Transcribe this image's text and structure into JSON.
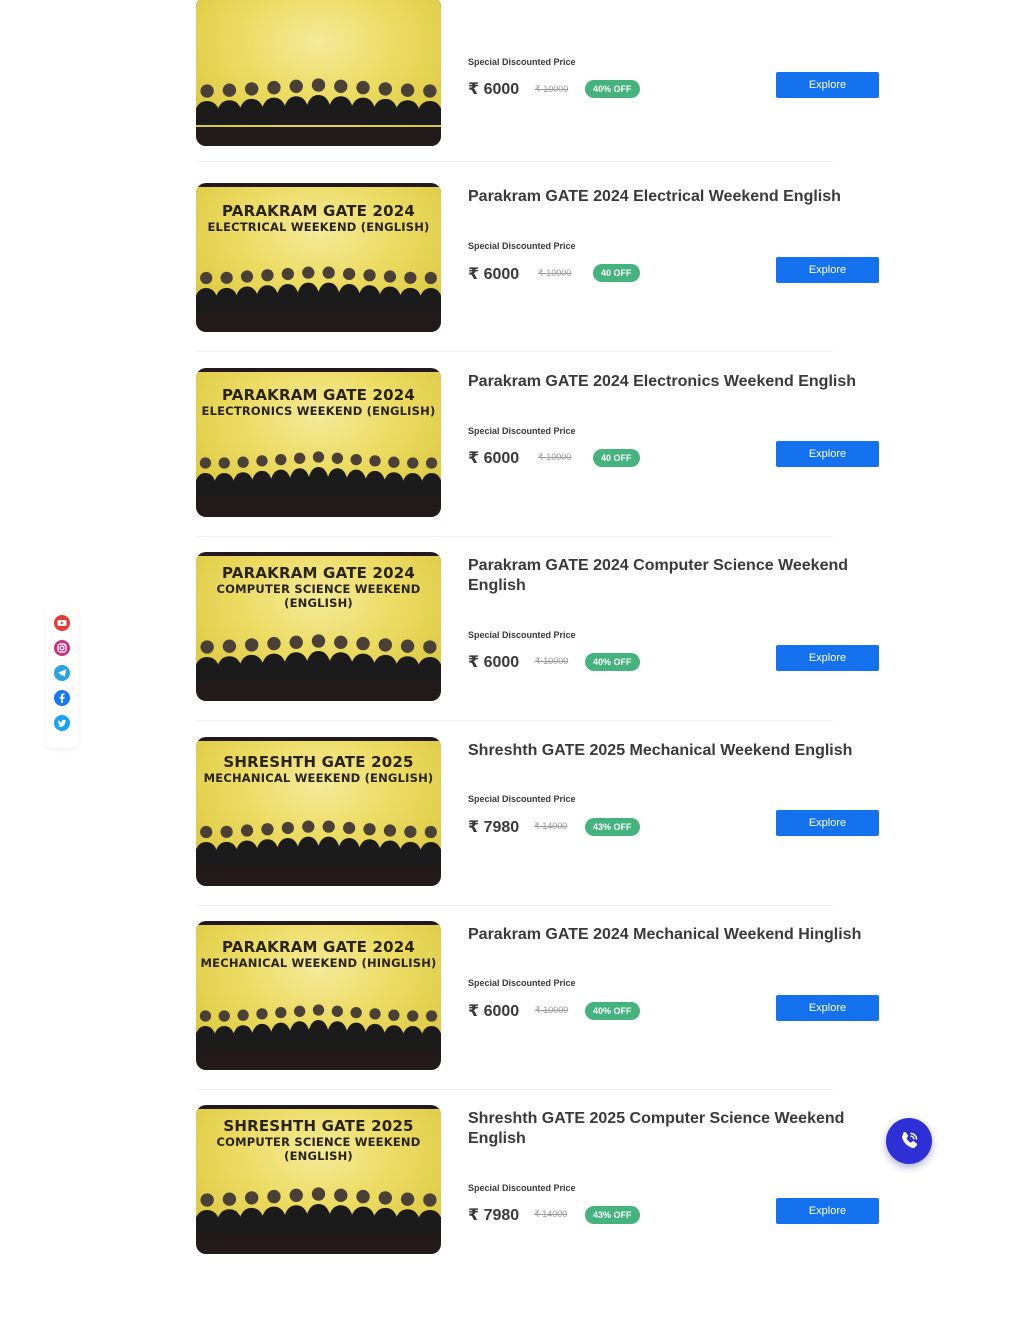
{
  "courses": [
    {
      "thumb_line1": "",
      "thumb_line2": "",
      "thumb_line3": "",
      "title": "",
      "price_label": "Special Discounted Price",
      "price": "₹ 6000",
      "mrp": "₹ 10000",
      "discount": "40% OFF",
      "explore_label": "Explore"
    },
    {
      "thumb_line1": "PARAKRAM GATE 2024",
      "thumb_line2": "ELECTRICAL WEEKEND (ENGLISH)",
      "thumb_line3": "",
      "title": "Parakram GATE 2024 Electrical Weekend English",
      "price_label": "Special Discounted Price",
      "price": "₹ 6000",
      "mrp": "₹ 10000",
      "discount": "40 OFF",
      "explore_label": "Explore"
    },
    {
      "thumb_line1": "PARAKRAM GATE 2024",
      "thumb_line2": "ELECTRONICS WEEKEND (ENGLISH)",
      "thumb_line3": "",
      "title": "Parakram GATE 2024 Electronics Weekend English",
      "price_label": "Special Discounted Price",
      "price": "₹ 6000",
      "mrp": "₹ 10000",
      "discount": "40 OFF",
      "explore_label": "Explore"
    },
    {
      "thumb_line1": "PARAKRAM GATE 2024",
      "thumb_line2": "COMPUTER SCIENCE WEEKEND",
      "thumb_line3": "(ENGLISH)",
      "title": "Parakram GATE 2024 Computer Science Weekend English",
      "price_label": "Special Discounted Price",
      "price": "₹ 6000",
      "mrp": "₹ 10000",
      "discount": "40% OFF",
      "explore_label": "Explore"
    },
    {
      "thumb_line1": "SHRESHTH GATE 2025",
      "thumb_line2": "MECHANICAL WEEKEND (ENGLISH)",
      "thumb_line3": "",
      "title": "Shreshth GATE 2025 Mechanical Weekend English",
      "price_label": "Special Discounted Price",
      "price": "₹ 7980",
      "mrp": "₹ 14000",
      "discount": "43% OFF",
      "explore_label": "Explore"
    },
    {
      "thumb_line1": "PARAKRAM GATE 2024",
      "thumb_line2": "MECHANICAL WEEKEND (HINGLISH)",
      "thumb_line3": "",
      "title": "Parakram GATE 2024 Mechanical Weekend Hinglish",
      "price_label": "Special Discounted Price",
      "price": "₹ 6000",
      "mrp": "₹ 10000",
      "discount": "40% OFF",
      "explore_label": "Explore"
    },
    {
      "thumb_line1": "SHRESHTH GATE 2025",
      "thumb_line2": "COMPUTER SCIENCE WEEKEND",
      "thumb_line3": "(ENGLISH)",
      "title": "Shreshth GATE 2025 Computer Science Weekend English",
      "price_label": "Special Discounted Price",
      "price": "₹ 7980",
      "mrp": "₹ 14000",
      "discount": "43% OFF",
      "explore_label": "Explore"
    }
  ],
  "social": [
    {
      "name": "youtube-icon",
      "color": "#e53935"
    },
    {
      "name": "instagram-icon",
      "color": "#c13584"
    },
    {
      "name": "telegram-icon",
      "color": "#2aa3df"
    },
    {
      "name": "facebook-icon",
      "color": "#1877f2"
    },
    {
      "name": "twitter-icon",
      "color": "#1da1f2"
    }
  ],
  "call_fab": {
    "icon": "phone-call-icon",
    "color": "#2f2fd6"
  },
  "colors": {
    "accent": "#1472ee",
    "discount_badge": "#44b37e",
    "thumb_bg": "#ecdc63"
  }
}
